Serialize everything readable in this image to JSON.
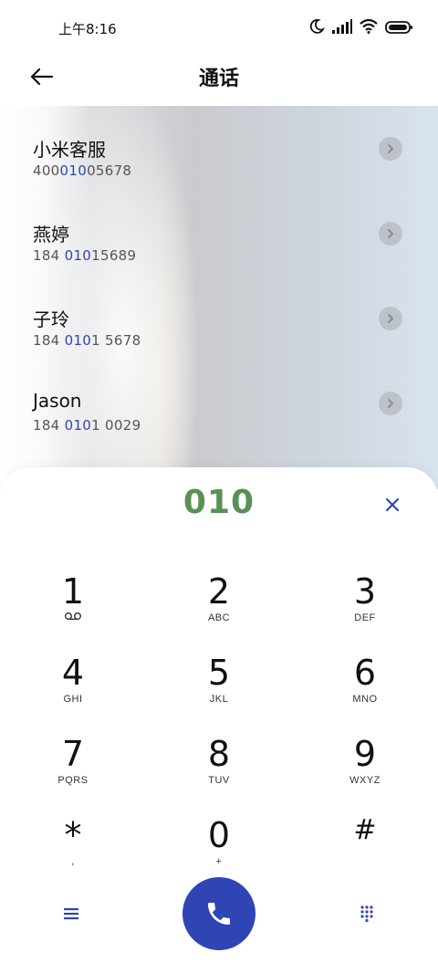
{
  "status_bar": {
    "time": "上午8:16"
  },
  "header": {
    "title": "通话"
  },
  "contacts": [
    {
      "name": "小米客服",
      "number_pre": "400",
      "number_match": "010",
      "number_post": "05678"
    },
    {
      "name": "燕婷",
      "number_pre": "184 ",
      "number_match": "010",
      "number_post": "15689"
    },
    {
      "name": "子玲",
      "number_pre": "184 ",
      "number_match": "010",
      "number_post": "1 5678"
    },
    {
      "name": "Jason",
      "number_pre": "184 ",
      "number_match": "010",
      "number_post": "1 0029"
    }
  ],
  "dialer": {
    "input": "010",
    "keys": [
      {
        "digit": "1",
        "letters": ""
      },
      {
        "digit": "2",
        "letters": "ABC"
      },
      {
        "digit": "3",
        "letters": "DEF"
      },
      {
        "digit": "4",
        "letters": "GHI"
      },
      {
        "digit": "5",
        "letters": "JKL"
      },
      {
        "digit": "6",
        "letters": "MNO"
      },
      {
        "digit": "7",
        "letters": "PQRS"
      },
      {
        "digit": "8",
        "letters": "TUV"
      },
      {
        "digit": "9",
        "letters": "WXYZ"
      },
      {
        "digit": "*",
        "letters": ","
      },
      {
        "digit": "0",
        "letters": "+"
      },
      {
        "digit": "#",
        "letters": ""
      }
    ]
  },
  "colors": {
    "accent": "#2f45b5",
    "dialed_text": "#5a8f55"
  },
  "icons": [
    "moon-icon",
    "signal-icon",
    "wifi-icon",
    "battery-icon",
    "back-arrow-icon",
    "chevron-right-icon",
    "clear-icon",
    "voicemail-icon",
    "menu-icon",
    "call-icon",
    "keypad-icon"
  ]
}
